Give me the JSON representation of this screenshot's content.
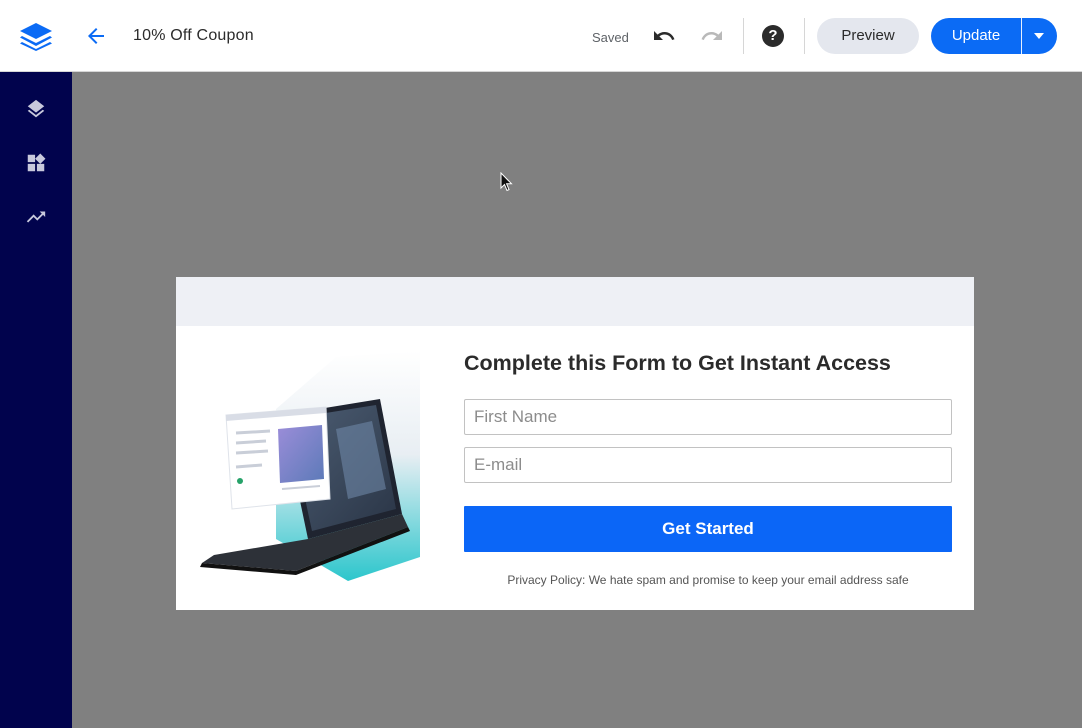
{
  "header": {
    "title": "10% Off Coupon",
    "saved_status": "Saved",
    "preview_label": "Preview",
    "update_label": "Update",
    "help_label": "?"
  },
  "sidebar": {
    "items": [
      {
        "icon": "layers-icon"
      },
      {
        "icon": "widgets-icon"
      },
      {
        "icon": "trending-up-icon"
      }
    ]
  },
  "popup": {
    "headline": "Complete this Form to Get Instant Access",
    "first_name_placeholder": "First Name",
    "email_placeholder": "E-mail",
    "cta_label": "Get Started",
    "privacy_text": "Privacy Policy: We hate spam and promise to keep your email address safe"
  },
  "colors": {
    "brand_blue": "#0b6bf5",
    "sidebar_bg": "#01034d",
    "canvas_bg": "#808080",
    "preview_bg": "#e4e7ee"
  }
}
